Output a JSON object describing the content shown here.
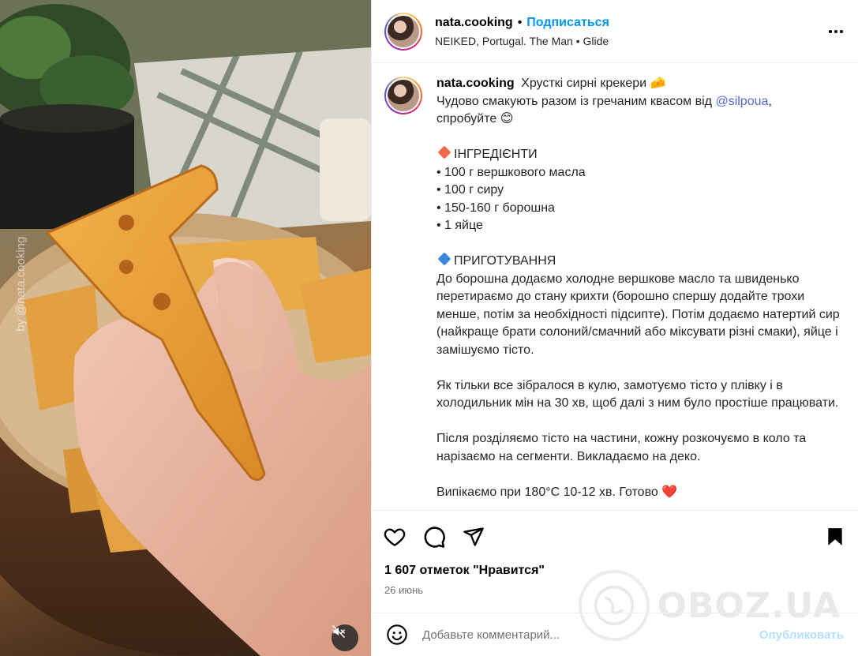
{
  "post": {
    "username": "nata.cooking",
    "follow_label": "Подписаться",
    "separator": "•",
    "audio": "NEIKED, Portugal. The Man • Glide"
  },
  "media": {
    "watermark": "by @nata.cooking"
  },
  "caption": {
    "username": "nata.cooking",
    "title": "Хрусткі сирні крекери 🧀",
    "line2_before": "Чудово смакують разом із гречаним квасом від ",
    "mention": "@silpoua",
    "line2_after": ",",
    "line3": "спробуйте 😊",
    "ingredients_header": "ІНГРЕДІЄНТИ",
    "ingredients": [
      "• 100 г вершкового масла",
      "• 100 г сиру",
      "• 150-160 г борошна",
      "• 1 яйце"
    ],
    "cooking_header": "ПРИГОТУВАННЯ",
    "paragraph1": "До борошна додаємо холодне вершкове масло та швиденько перетираємо до стану крихти (борошно спершу додайте трохи менше, потім за необхідності підсипте). Потім додаємо натертий сир (найкраще брати солоний/смачний або міксувати різні смаки), яйце і замішуємо тісто.",
    "paragraph2": "Як тільки все зібралося в кулю, замотуємо тісто у плівку і в холодильник мін на 30 хв, щоб далі з ним було простіше працювати.",
    "paragraph3": "Після розділяємо тісто на частини, кожну розкочуємо в коло та нарізаємо на сегменти. Викладаємо на деко.",
    "paragraph4_partial": "Випікаємо при 180°С 10-12 хв. Готово ❤️"
  },
  "actions": {
    "likes": "1 607 отметок \"Нравится\"",
    "date": "26 июнь"
  },
  "comment": {
    "placeholder": "Добавьте комментарий...",
    "publish_label": "Опубликовать"
  },
  "watermark": {
    "text": "OBOZ.UA"
  },
  "colors": {
    "link_blue": "#0095f6",
    "ingredients_diamond": "#f26a4b",
    "cooking_diamond": "#3b88d8"
  },
  "icons": {
    "like": "heart-icon",
    "comment": "comment-icon",
    "share": "paper-plane-icon",
    "save": "bookmark-icon",
    "emoji": "smiley-icon",
    "more": "more-horizontal-icon",
    "mute": "speaker-muted-icon"
  }
}
